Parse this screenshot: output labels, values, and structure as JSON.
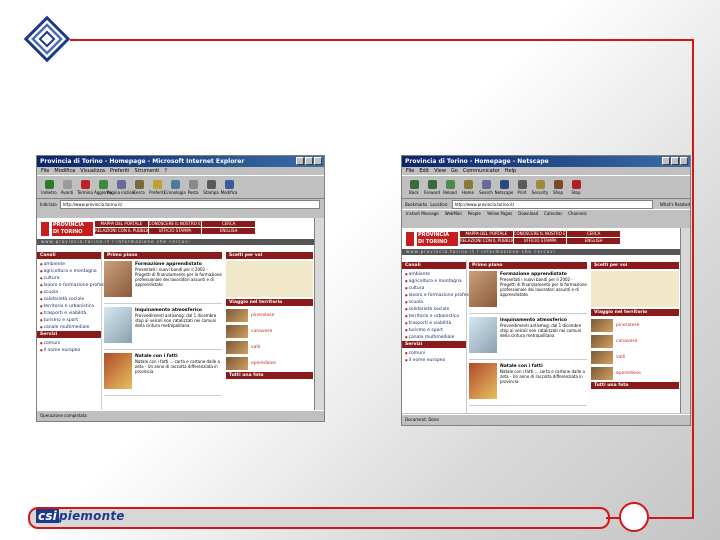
{
  "slide": {
    "brand_part1": "csi",
    "brand_part2": "piemonte",
    "accent_color": "#d41616"
  },
  "ie_window": {
    "title": "Provincia di Torino - Homepage - Microsoft Internet Explorer",
    "menu": [
      "File",
      "Modifica",
      "Visualizza",
      "Preferiti",
      "Strumenti",
      "?"
    ],
    "toolbar": [
      "Indietro",
      "Avanti",
      "Termina",
      "Aggiorna",
      "Pagina iniziale",
      "Cerca",
      "Preferiti",
      "Cronologia",
      "Posta",
      "Stampa",
      "Modifica"
    ],
    "address_label": "Indirizzo",
    "address": "http://www.provincia.torino.it/",
    "status": "Operazione completata"
  },
  "ns_window": {
    "title": "Provincia di Torino - Homepage - Netscape",
    "menu": [
      "File",
      "Edit",
      "View",
      "Go",
      "Communicator",
      "Help"
    ],
    "toolbar": [
      "Back",
      "Forward",
      "Reload",
      "Home",
      "Search",
      "Netscape",
      "Print",
      "Security",
      "Shop",
      "Stop"
    ],
    "address_label": "Location:",
    "address": "http://www.provincia.torino.it/",
    "bookmarks_label": "Bookmarks",
    "whats_related": "What's Related",
    "links": [
      "Instant Message",
      "WebMail",
      "People",
      "Yellow Pages",
      "Download",
      "Calendar",
      "Channels"
    ],
    "status": "Document: Done"
  },
  "site": {
    "name_line1": "PROVINCIA",
    "name_line2": "DI TORINO",
    "nav": [
      "MAPPA DEL PORTALE",
      "CONOSCERE IL NOSTRO ENTE",
      "CERCA",
      "RELAZIONI CON IL PUBBLICO",
      "UFFICIO STAMPA",
      "ENGLISH"
    ],
    "tagline": "www.provincia.torino.it l'informazione che cercavi",
    "canali_title": "Canali",
    "canali": [
      "ambiente",
      "agricoltura e montagna",
      "cultura",
      "lavoro e formazione professionale",
      "scuola",
      "solidarietà sociale",
      "territorio e urbanistica",
      "trasporti e viabilità",
      "turismo e sport",
      "canale multimediale"
    ],
    "servizi_title": "Servizi",
    "servizi": [
      "comuni",
      "il nome europeo"
    ],
    "primo_piano_title": "Primo piano",
    "news": [
      {
        "title": "Formazione apprendistato",
        "text": "Presentati i nuovi bandi per il 2002 - Progetti di finanziamento per la formazione professionale dei lavoratori assunti e di apprendistato"
      },
      {
        "title": "Inquinamento atmosferico",
        "text": "Provvedimenti antismog: dal 1 dicembre stop ai veicoli non catalizzati nei comuni della cintura metropolitana"
      },
      {
        "title": "Natale con i fatti",
        "text": "Natale con i fatti ... carta e cartone dalle a zeta - Un anno di raccolta differenziata in provincia"
      }
    ],
    "scelti_title": "Scelti per voi",
    "viaggio_title": "Viaggio nel territorio",
    "viaggio": [
      "pinerolese",
      "canavese",
      "valli",
      "eporediese"
    ],
    "tutti_title": "Tutti una foto"
  }
}
